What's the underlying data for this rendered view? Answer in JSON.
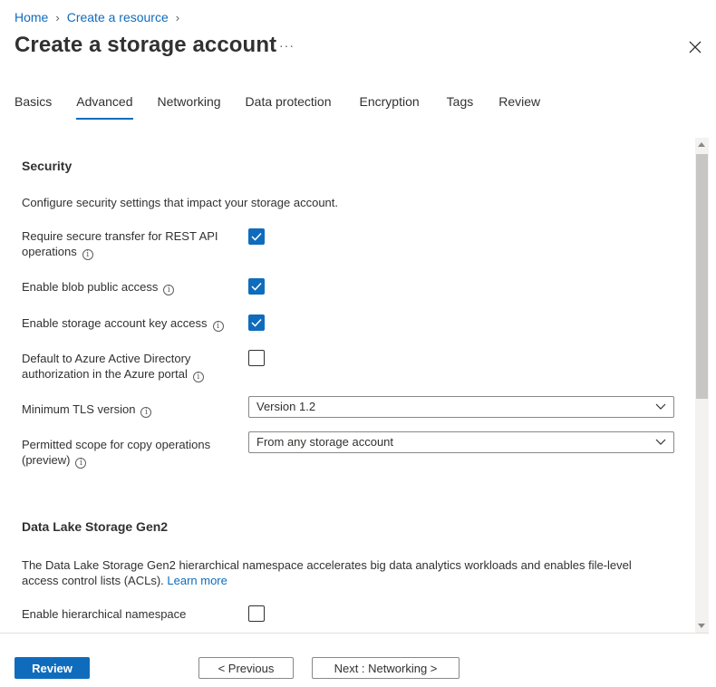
{
  "breadcrumb": {
    "home": "Home",
    "create_resource": "Create a resource"
  },
  "page": {
    "title": "Create a storage account",
    "more": "···"
  },
  "tabs": [
    {
      "label": "Basics"
    },
    {
      "label": "Advanced"
    },
    {
      "label": "Networking"
    },
    {
      "label": "Data protection"
    },
    {
      "label": "Encryption"
    },
    {
      "label": "Tags"
    },
    {
      "label": "Review"
    }
  ],
  "security": {
    "title": "Security",
    "description": "Configure security settings that impact your storage account.",
    "fields": {
      "secure_transfer": {
        "label": "Require secure transfer for REST API operations",
        "checked": true
      },
      "blob_public": {
        "label": "Enable blob public access",
        "checked": true
      },
      "key_access": {
        "label": "Enable storage account key access",
        "checked": true
      },
      "aad_default": {
        "label": "Default to Azure Active Directory authorization in the Azure portal",
        "checked": false
      },
      "tls": {
        "label": "Minimum TLS version",
        "value": "Version 1.2"
      },
      "copy_scope": {
        "label": "Permitted scope for copy operations (preview)",
        "value": "From any storage account"
      }
    }
  },
  "datalake": {
    "title": "Data Lake Storage Gen2",
    "description": "The Data Lake Storage Gen2 hierarchical namespace accelerates big data analytics workloads and enables file-level access control lists (ACLs).",
    "learn_more": "Learn more",
    "hns": {
      "label": "Enable hierarchical namespace",
      "checked": false
    }
  },
  "footer": {
    "review": "Review",
    "previous": "< Previous",
    "next": "Next : Networking >"
  },
  "colors": {
    "accent": "#0f6cbd",
    "text": "#323130",
    "border": "#8a8886"
  },
  "icons": {
    "close": "close-icon",
    "info": "info-icon",
    "check": "checkmark-icon",
    "chevron": "chevron-down-icon",
    "more": "more-icon"
  }
}
